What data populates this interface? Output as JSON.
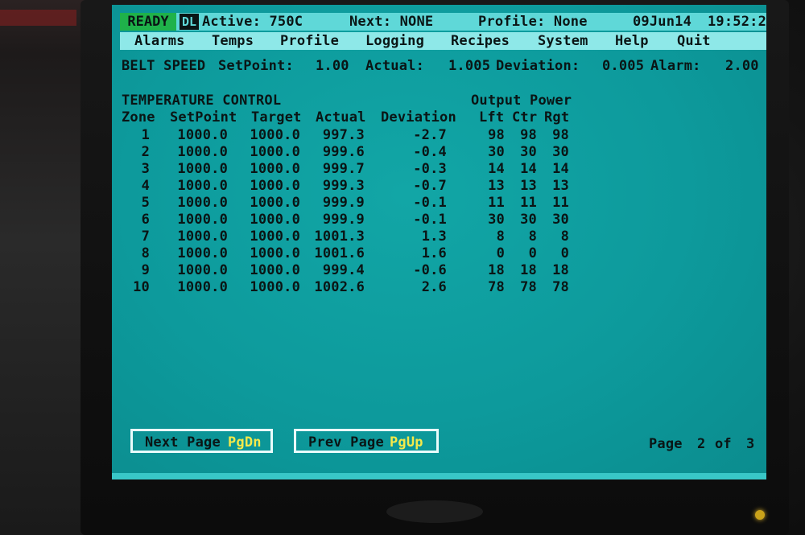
{
  "status_bar": {
    "ready": "READY",
    "dl": "DL",
    "active": "Active: 750C",
    "next": "Next: NONE",
    "profile": "Profile: None",
    "date": "09Jun14",
    "time": "19:52:2"
  },
  "menu": [
    "Alarms",
    "Temps",
    "Profile",
    "Logging",
    "Recipes",
    "System",
    "Help",
    "Quit"
  ],
  "belt": {
    "label": "BELT SPEED",
    "setpoint_label": "SetPoint:",
    "setpoint": "1.00",
    "actual_label": "Actual:",
    "actual": "1.005",
    "deviation_label": "Deviation:",
    "deviation": "0.005",
    "alarm_label": "Alarm:",
    "alarm": "2.00"
  },
  "temp": {
    "title": "TEMPERATURE CONTROL",
    "output_power": "Output Power",
    "headers": [
      "Zone",
      "SetPoint",
      "Target",
      "Actual",
      "Deviation",
      "Lft",
      "Ctr",
      "Rgt"
    ],
    "rows": [
      [
        "1",
        "1000.0",
        "1000.0",
        "997.3",
        "-2.7",
        "98",
        "98",
        "98"
      ],
      [
        "2",
        "1000.0",
        "1000.0",
        "999.6",
        "-0.4",
        "30",
        "30",
        "30"
      ],
      [
        "3",
        "1000.0",
        "1000.0",
        "999.7",
        "-0.3",
        "14",
        "14",
        "14"
      ],
      [
        "4",
        "1000.0",
        "1000.0",
        "999.3",
        "-0.7",
        "13",
        "13",
        "13"
      ],
      [
        "5",
        "1000.0",
        "1000.0",
        "999.9",
        "-0.1",
        "11",
        "11",
        "11"
      ],
      [
        "6",
        "1000.0",
        "1000.0",
        "999.9",
        "-0.1",
        "30",
        "30",
        "30"
      ],
      [
        "7",
        "1000.0",
        "1000.0",
        "1001.3",
        "1.3",
        "8",
        "8",
        "8"
      ],
      [
        "8",
        "1000.0",
        "1000.0",
        "1001.6",
        "1.6",
        "0",
        "0",
        "0"
      ],
      [
        "9",
        "1000.0",
        "1000.0",
        "999.4",
        "-0.6",
        "18",
        "18",
        "18"
      ],
      [
        "10",
        "1000.0",
        "1000.0",
        "1002.6",
        "2.6",
        "78",
        "78",
        "78"
      ]
    ]
  },
  "buttons": {
    "next": "Next Page",
    "next_key": "PgDn",
    "prev": "Prev Page",
    "prev_key": "PgUp"
  },
  "page": {
    "label": "Page",
    "current": "2",
    "of": "of",
    "total": "3"
  },
  "colors": {
    "screen_bg": "#0d9a9c",
    "status_bg": "#5fd8d8",
    "menu_bg": "#8ee8e8",
    "ready_bg": "#1fb24a",
    "key_text": "#f4e94a"
  }
}
